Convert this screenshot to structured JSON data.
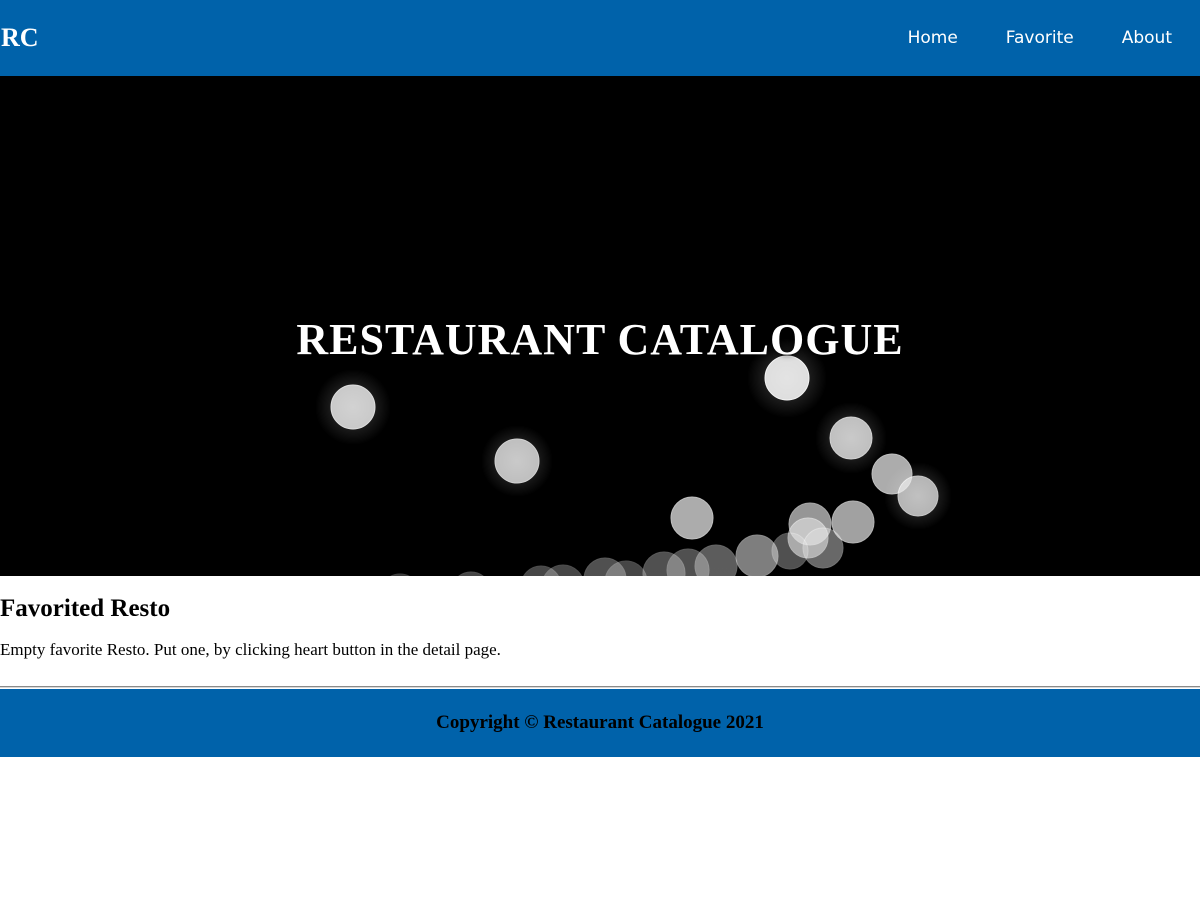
{
  "header": {
    "brand": "RC",
    "nav": [
      {
        "label": "Home"
      },
      {
        "label": "Favorite"
      },
      {
        "label": "About"
      }
    ]
  },
  "hero": {
    "title": "RESTAURANT CATALOGUE"
  },
  "favorites": {
    "title": "Favorited Resto",
    "empty_message": "Empty favorite Resto. Put one, by clicking heart button in the detail page."
  },
  "footer": {
    "copyright": "Copyright © Restaurant Catalogue 2021"
  },
  "colors": {
    "app_bar": "#0062aa",
    "footer": "#0062aa",
    "hero_background": "#000000"
  }
}
